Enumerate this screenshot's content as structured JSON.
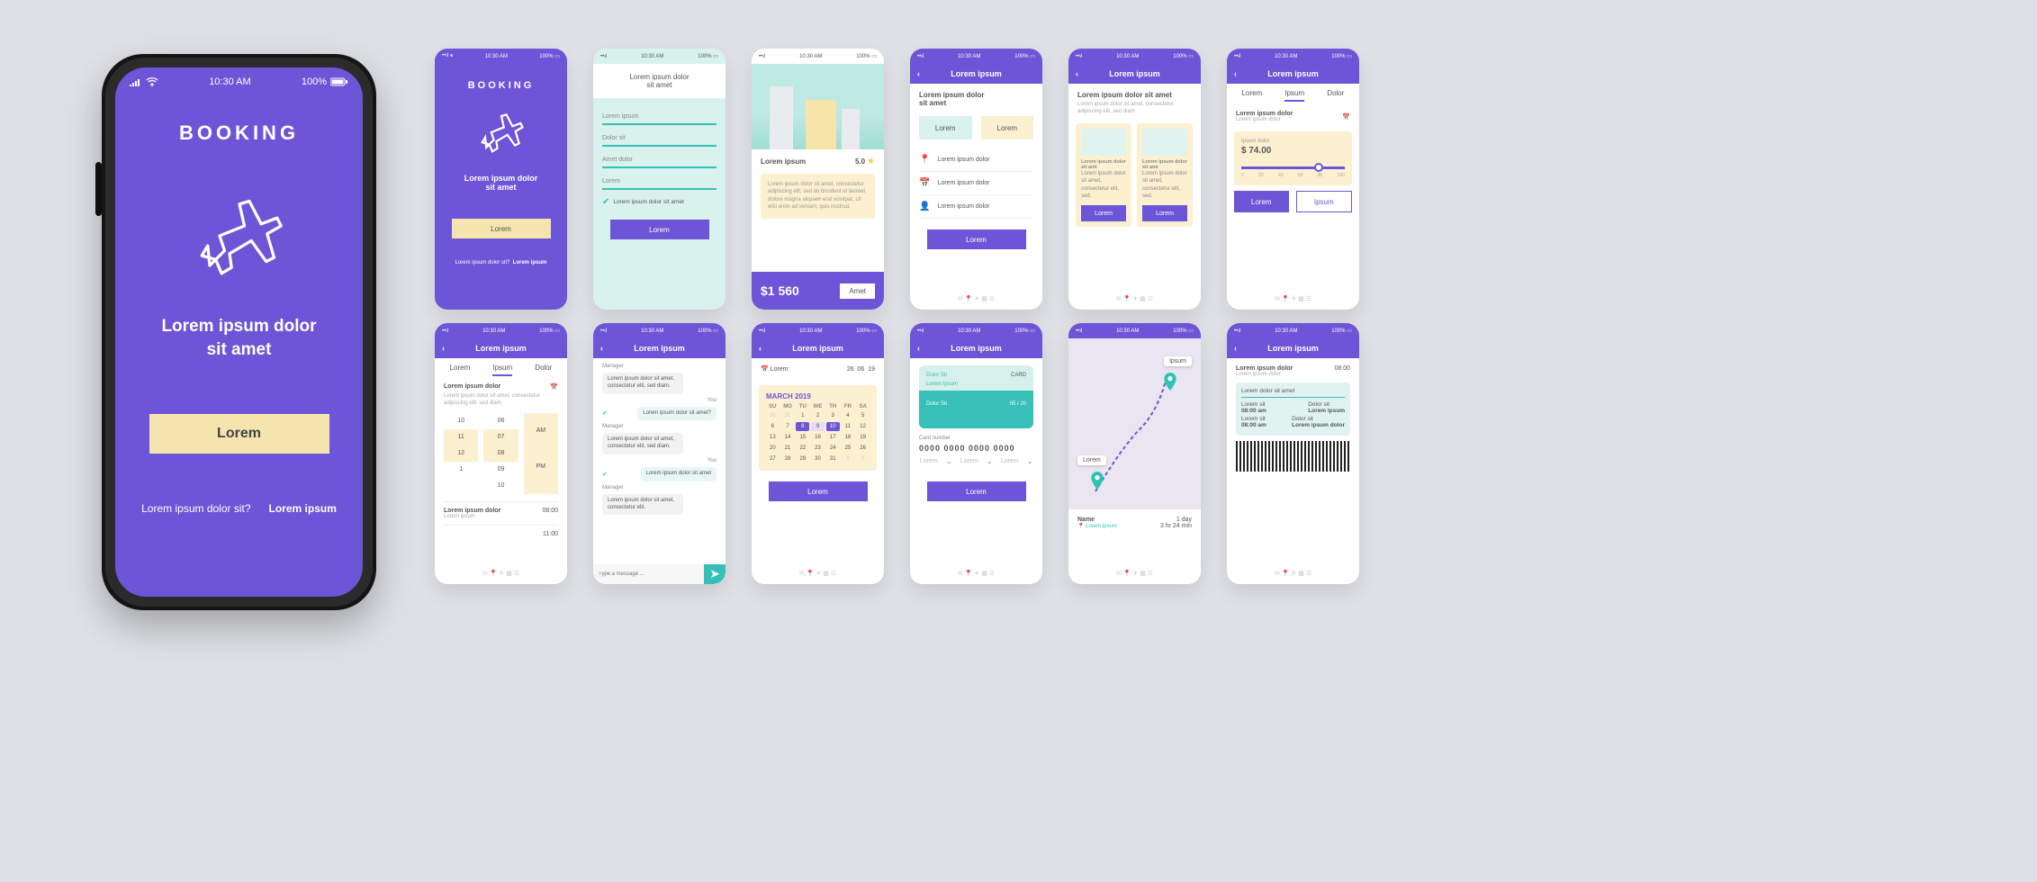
{
  "status": {
    "time": "10:30 AM",
    "battery": "100%"
  },
  "hero": {
    "title": "BOOKING",
    "subtitle1": "Lorem ipsum dolor",
    "subtitle2": "sit amet",
    "btn": "Lorem",
    "footQ": "Lorem ipsum dolor sit?",
    "footA": "Lorem ipsum"
  },
  "s1": {
    "title": "BOOKING",
    "sub1": "Lorem ipsum dolor",
    "sub2": "sit amet",
    "btn": "Lorem",
    "footQ": "Lorem ipsum dolor sit?",
    "footA": "Lorem ipsum"
  },
  "s2": {
    "head1": "Lorem ipsum dolor",
    "head2": "sit amet",
    "f1": "Lorem ipsum",
    "f2": "Dolor sit",
    "f3": "Amet dolor",
    "f4": "Lorem",
    "chk": "Lorem ipsum dolor sit amet",
    "btn": "Lorem"
  },
  "s3": {
    "name": "Lorem ipsum",
    "rating": "5.0",
    "body": "Lorem ipsum dolor sit amet, consectetur adipiscing elit, sed do tincidunt ut laoreet dolore magna aliquam erat volutpat. Ut wisi enim ad veniam, quis nostrud.",
    "price": "$1 560",
    "cta": "Amet"
  },
  "s4": {
    "title": "Lorem ipsum",
    "h1": "Lorem ipsum dolor",
    "h2": "sit amet",
    "chipA": "Lorem",
    "chipB": "Lorem",
    "r1": "Lorem ipsum dolor",
    "r2": "Lorem ipsum dolor",
    "r3": "Lorem ipsum dolor",
    "btn": "Lorem"
  },
  "s5": {
    "title": "Lorem ipsum",
    "h1": "Lorem ipsum dolor sit amet",
    "sub": "Lorem ipsum dolor sit amet, consectetur adipiscing elit, sed diam",
    "cardT": "Lorem ipsum dolor sit amt",
    "cardB": "Lorem ipsum dolor sit amet, consectetur elit, sed.",
    "btn": "Lorem"
  },
  "s6": {
    "title": "Lorem ipsum",
    "tab1": "Lorem",
    "tab2": "Ipsum",
    "tab3": "Dolor",
    "sec": "Lorem ipsum dolor",
    "sub": "Lorem ipsum dolor",
    "priceLab": "Ipsum dolor",
    "price": "$ 74.00",
    "rng": [
      "0",
      "20",
      "40",
      "60",
      "80",
      "100"
    ],
    "btn1": "Lorem",
    "btn2": "Ipsum"
  },
  "s7": {
    "title": "Lorem ipsum",
    "tab1": "Lorem",
    "tab2": "Ipsum",
    "tab3": "Dolor",
    "h1": "Lorem ipsum dolor",
    "sub": "Lorem ipsum dolor sit amet, consectetur adipiscing elit, sed diam",
    "cols": [
      [
        "10",
        "11",
        "12",
        "1"
      ],
      [
        "06",
        "07",
        "08",
        "09",
        "10"
      ]
    ],
    "am": "AM",
    "pm": "PM",
    "s2": "Lorem ipsum dolor",
    "s2sub": "Lorem ipsum",
    "t1": "08:00",
    "t2": "11:00"
  },
  "s8": {
    "title": "Lorem ipsum",
    "mgr": "Manager",
    "you": "You",
    "b1": "Lorem ipsum dolor sit amet, consectetur elit, sed diam.",
    "b2": "Lorem ipsum dolor sit amet?",
    "b3": "Lorem ipsum dolor sit amet, consectetur elit, sed diam.",
    "b4": "Lorem ipsum dolor sit amet",
    "b5": "Lorem ipsum dolor sit amet, consectetur elit.",
    "ph": "Type a message ..."
  },
  "s9": {
    "title": "Lorem ipsum",
    "dateLab": "Lorem:",
    "date": [
      "26",
      "06",
      "19"
    ],
    "month": "MARCH 2019",
    "dh": [
      "SU",
      "MO",
      "TU",
      "WE",
      "TH",
      "FR",
      "SA"
    ],
    "days": [
      30,
      31,
      1,
      2,
      3,
      4,
      5,
      6,
      7,
      8,
      9,
      10,
      11,
      12,
      13,
      14,
      15,
      16,
      17,
      18,
      19,
      20,
      21,
      22,
      23,
      24,
      25,
      26,
      27,
      28,
      29,
      30,
      31,
      1,
      2
    ],
    "btn": "Lorem"
  },
  "s10": {
    "title": "Lorem ipsum",
    "brand": "Dolor Sit",
    "type": "CARD",
    "name": "Lorem Ipsum",
    "nLab": "Dolor Sit",
    "nVal": "05 / 20",
    "cnLab": "Card number",
    "cn": "0000 0000 0000 0000",
    "d1": "Lorem",
    "d2": "Lorem",
    "d3": "Lorem",
    "btn": "Lorem"
  },
  "s11": {
    "pin1": "Ipsum",
    "pin2": "Lorem",
    "nLab": "Name",
    "dur1": "1 day",
    "dur2": "3 hr  24 min"
  },
  "s12": {
    "title": "Lorem ipsum",
    "h1": "Lorem ipsum dolor",
    "h1sub": "Lorem ipsum dolor",
    "t": "08:00",
    "bLab": "Lorem dolor sit amet",
    "c1a": "Lorem sit",
    "c1b": "08:00 am",
    "c2a": "Dolor sit",
    "c2b": "Lorem ipsum",
    "c3a": "Lorem sit",
    "c3b": "08:00 am",
    "c4a": "Dolor sit",
    "c4b": "Lorem ipsum dolor"
  }
}
